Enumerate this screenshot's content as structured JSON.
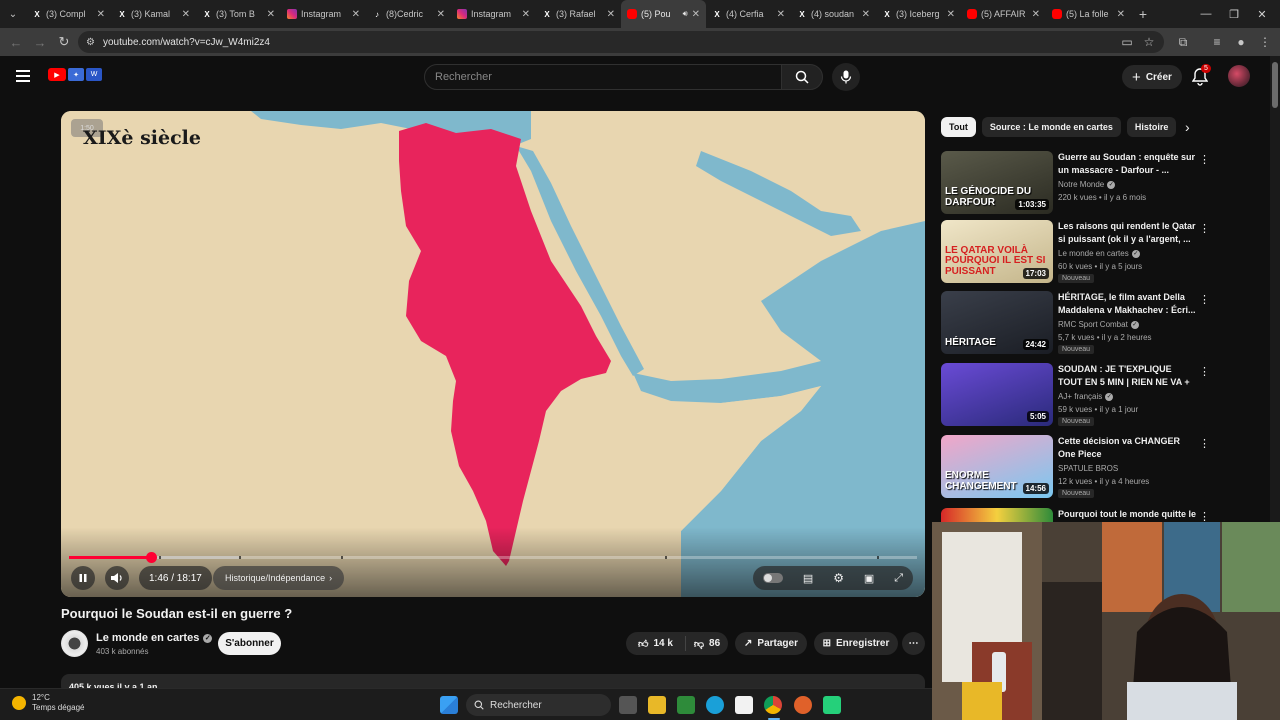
{
  "browser": {
    "tabs": [
      {
        "icon": "x-icon",
        "title": "(3) Compl",
        "active": false
      },
      {
        "icon": "x-icon",
        "title": "(3) Kamal",
        "active": false
      },
      {
        "icon": "x-icon",
        "title": "(3) Tom B",
        "active": false
      },
      {
        "icon": "instagram-icon",
        "title": "Instagram",
        "active": false
      },
      {
        "icon": "tiktok-icon",
        "title": "(8)Cedric",
        "active": false
      },
      {
        "icon": "instagram-icon",
        "title": "Instagram",
        "active": false
      },
      {
        "icon": "x-icon",
        "title": "(3) Rafael",
        "active": false
      },
      {
        "icon": "youtube-icon",
        "title": "(5) Pou",
        "active": true
      },
      {
        "icon": "x-icon",
        "title": "(4) Cerfia",
        "active": false
      },
      {
        "icon": "x-icon",
        "title": "(4) soudan",
        "active": false
      },
      {
        "icon": "x-icon",
        "title": "(3) Iceberg",
        "active": false
      },
      {
        "icon": "youtube-icon",
        "title": "(5) AFFAIR",
        "active": false
      },
      {
        "icon": "youtube-icon",
        "title": "(5) La folle",
        "active": false
      }
    ],
    "url": "youtube.com/watch?v=cJw_W4mi2z4"
  },
  "youtube": {
    "search_placeholder": "Rechercher",
    "create_label": "Créer",
    "notification_count": "5"
  },
  "player": {
    "overlay_title": "XIXè siècle",
    "overlay_badge": "1:50",
    "current_time": "1:46",
    "duration": "18:17",
    "time_display": "1:46 / 18:17",
    "played_fraction": 0.0967,
    "buffered_fraction": 0.2,
    "chapter_label": "Historique/Indépendance"
  },
  "video": {
    "title": "Pourquoi le Soudan est-il en guerre ?",
    "channel": "Le monde en cartes",
    "subscribers": "403 k abonnés",
    "subscribe_label": "S'abonner",
    "likes": "14 k",
    "dislikes": "86",
    "share_label": "Partager",
    "save_label": "Enregistrer",
    "description_preview": "405 k vues  il y a 1 an"
  },
  "chips": [
    "Tout",
    "Source : Le monde en cartes",
    "Histoire"
  ],
  "recommendations": [
    {
      "title": "Guerre au Soudan : enquête sur un massacre - Darfour - ...",
      "channel": "Notre Monde",
      "verified": true,
      "meta": "220 k vues • il y a 6 mois",
      "duration": "1:03:35",
      "badge": "",
      "thumb_text": "LE GÉNOCIDE DU DARFOUR"
    },
    {
      "title": "Les raisons qui rendent le Qatar si puissant (ok il y a l'argent, ...",
      "channel": "Le monde en cartes",
      "verified": true,
      "meta": "60 k vues • il y a 5 jours",
      "duration": "17:03",
      "badge": "Nouveau",
      "thumb_text": "LE QATAR VOILÀ POURQUOI IL EST SI PUISSANT"
    },
    {
      "title": "HÉRITAGE, le film avant Della Maddalena v Makhachev : Écri...",
      "channel": "RMC Sport Combat",
      "verified": true,
      "meta": "5,7 k vues • il y a 2 heures",
      "duration": "24:42",
      "badge": "Nouveau",
      "thumb_text": "HÉRITAGE"
    },
    {
      "title": "SOUDAN : JE T'EXPLIQUE TOUT EN 5 MIN | RIEN NE VA +",
      "channel": "AJ+ français",
      "verified": true,
      "meta": "59 k vues • il y a 1 jour",
      "duration": "5:05",
      "badge": "Nouveau",
      "thumb_text": ""
    },
    {
      "title": "Cette décision va CHANGER One Piece",
      "channel": "SPATULE BROS",
      "verified": false,
      "meta": "12 k vues • il y a 4 heures",
      "duration": "14:56",
      "badge": "Nouveau",
      "thumb_text": "ENORME CHANGEMENT"
    },
    {
      "title": "Pourquoi tout le monde quitte le Mali ?",
      "channel": "",
      "verified": false,
      "meta": "",
      "duration": "",
      "badge": "",
      "thumb_text": ""
    }
  ],
  "taskbar": {
    "temperature": "12°C",
    "weather": "Temps dégagé",
    "search_label": "Rechercher"
  },
  "colors": {
    "accent_red": "#ff0033",
    "map_region": "#e8245c",
    "sea": "#7fb8cc",
    "land": "#e8d6b0"
  }
}
